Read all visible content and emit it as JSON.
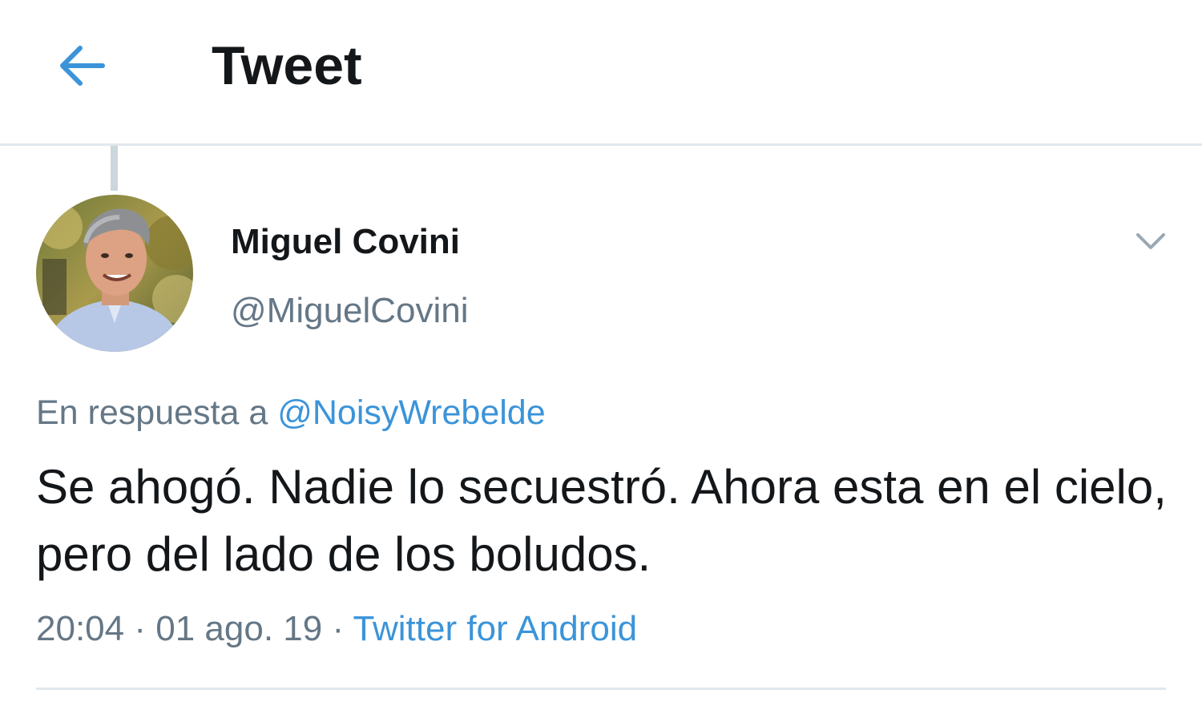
{
  "header": {
    "back_icon": "arrow-left-icon",
    "title": "Tweet",
    "accent_color": "#3b94d9"
  },
  "tweet": {
    "author": {
      "display_name": "Miguel Covini",
      "handle": "@MiguelCovini",
      "avatar_icon": "avatar"
    },
    "menu_icon": "chevron-down-icon",
    "reply_prefix": "En respuesta a",
    "reply_to": "@NoisyWrebelde",
    "text": "Se ahogó. Nadie lo secuestró. Ahora esta en el cielo, pero del lado de los boludos.",
    "time": "20:04",
    "separator": "·",
    "date": "01 ago. 19",
    "source": "Twitter for Android"
  },
  "colors": {
    "text_primary": "#14171a",
    "text_secondary": "#657786",
    "link": "#3b94d9",
    "divider": "#e1e8ed"
  }
}
